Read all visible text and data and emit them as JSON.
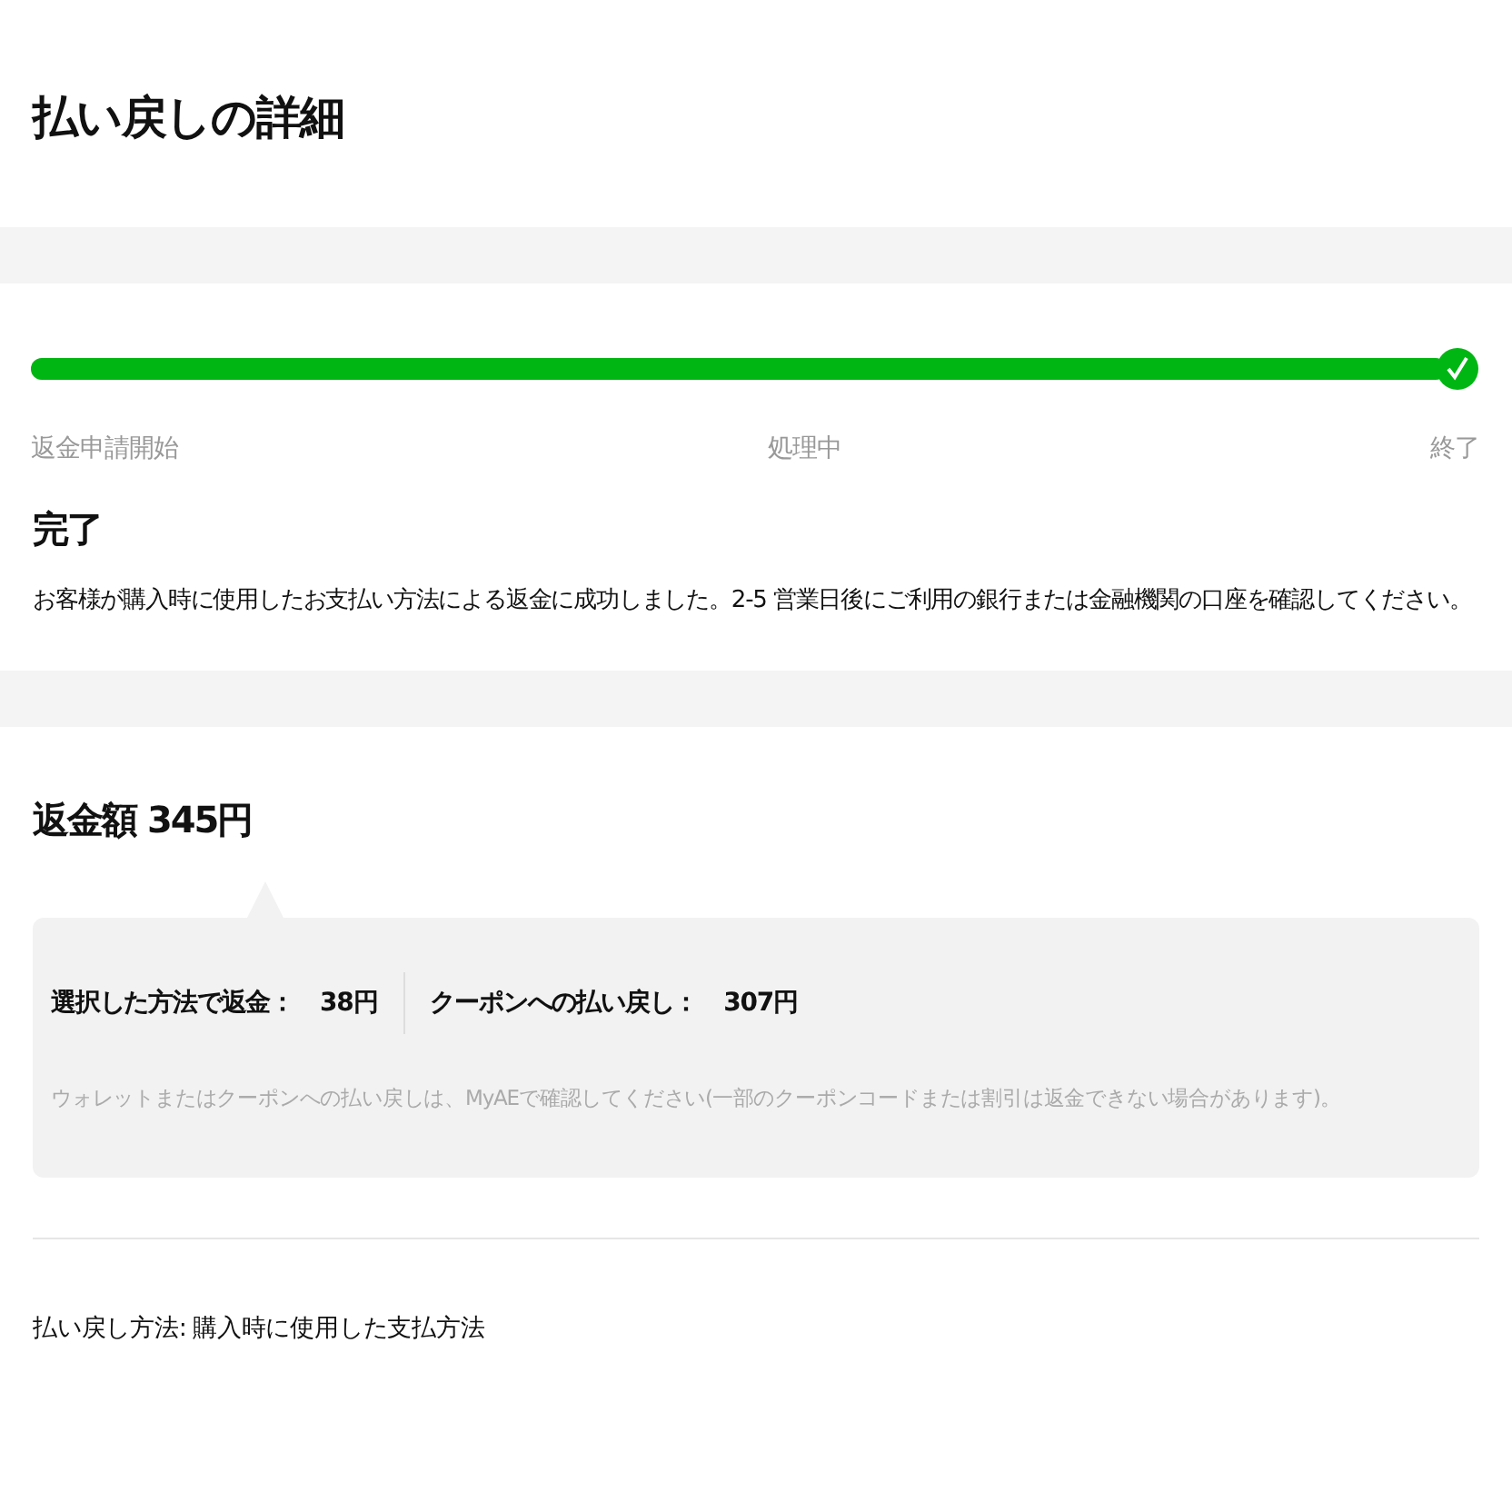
{
  "title": "払い戻しの詳細",
  "progress": {
    "level": 1,
    "steps": [
      {
        "label": "返金申請開始"
      },
      {
        "label": "処理中"
      },
      {
        "label": "終了"
      }
    ]
  },
  "status": {
    "heading": "完了",
    "message": "お客様が購入時に使用したお支払い方法による返金に成功しました。2-5 営業日後にご利用の銀行または金融機関の口座を確認してください。"
  },
  "refund": {
    "heading": "返金額 345円",
    "breakdown": [
      {
        "label": "選択した方法で返金：",
        "amount": "38円"
      },
      {
        "label": "クーポンへの払い戻し：",
        "amount": "307円"
      }
    ],
    "note": "ウォレットまたはクーポンへの払い戻しは、MyAEで確認してください(一部のクーポンコードまたは割引は返金できない場合があります)。"
  },
  "method": "払い戻し方法: 購入時に使用した支払方法"
}
